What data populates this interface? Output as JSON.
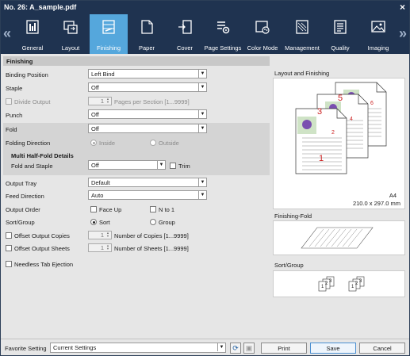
{
  "window": {
    "title": "No. 26: A_sample.pdf",
    "close_icon": "×"
  },
  "toolbar": {
    "prev_arrow": "«",
    "next_arrow": "»",
    "tabs": [
      {
        "label": "General",
        "icon": "general-icon"
      },
      {
        "label": "Layout",
        "icon": "layout-icon"
      },
      {
        "label": "Finishing",
        "icon": "finishing-icon",
        "active": true
      },
      {
        "label": "Paper",
        "icon": "paper-icon"
      },
      {
        "label": "Cover",
        "icon": "cover-icon"
      },
      {
        "label": "Page Settings",
        "icon": "page-settings-icon"
      },
      {
        "label": "Color Mode",
        "icon": "color-mode-icon"
      },
      {
        "label": "Management",
        "icon": "management-icon"
      },
      {
        "label": "Quality",
        "icon": "quality-icon"
      },
      {
        "label": "Imaging",
        "icon": "imaging-icon"
      }
    ],
    "accent": "#55a7dc",
    "background": "#1f3350"
  },
  "finishing": {
    "section_title": "Finishing",
    "binding_position": {
      "label": "Binding Position",
      "value": "Left Bind"
    },
    "staple": {
      "label": "Staple",
      "value": "Off"
    },
    "divide_output": {
      "label": "Divide Output",
      "value": "1",
      "suffix": "Pages per Section [1...9999]"
    },
    "punch": {
      "label": "Punch",
      "value": "Off"
    },
    "fold": {
      "label": "Fold",
      "value": "Off"
    },
    "folding_direction": {
      "label": "Folding Direction",
      "options": [
        "Inside",
        "Outside"
      ],
      "selected": "Inside"
    },
    "multi_half_fold": {
      "title": "Multi Half-Fold Details",
      "label": "Fold and Staple",
      "value": "Off",
      "trim_label": "Trim"
    },
    "output_tray": {
      "label": "Output Tray",
      "value": "Default"
    },
    "feed_direction": {
      "label": "Feed Direction",
      "value": "Auto"
    },
    "output_order": {
      "label": "Output Order",
      "face_up": "Face Up",
      "n_to_1": "N to 1"
    },
    "sort_group": {
      "label": "Sort/Group",
      "options": [
        "Sort",
        "Group"
      ],
      "selected": "Sort"
    },
    "offset_copies": {
      "label": "Offset Output Copies",
      "value": "1",
      "suffix": "Number of Copies [1...9999]"
    },
    "offset_sheets": {
      "label": "Offset Output Sheets",
      "value": "1",
      "suffix": "Number of Sheets [1...9999]"
    },
    "needless_tab": {
      "label": "Needless Tab Ejection"
    }
  },
  "preview": {
    "layout_title": "Layout and Finishing",
    "paper_size": "A4",
    "paper_dims": "210.0 x 297.0 mm",
    "page_numbers": [
      "1",
      "2",
      "3",
      "4",
      "5",
      "6"
    ],
    "finishing_fold_title": "Finishing-Fold",
    "sort_group_title": "Sort/Group",
    "sort_digits": [
      "1",
      "2",
      "3"
    ]
  },
  "bottom": {
    "favorite_label": "Favorite Setting",
    "favorite_value": "Current Settings",
    "refresh_icon": "⟳",
    "save_fav_icon": "▣",
    "print": "Print",
    "save": "Save",
    "cancel": "Cancel"
  }
}
